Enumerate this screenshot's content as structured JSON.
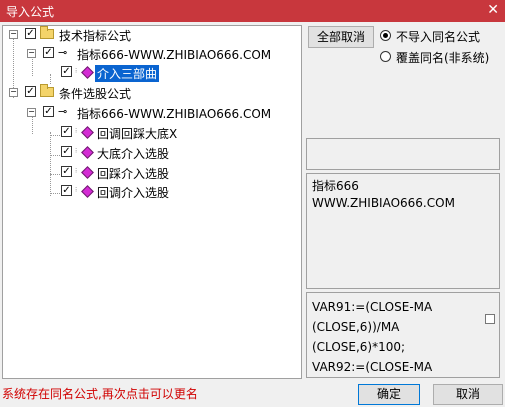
{
  "window": {
    "title": "导入公式",
    "close_glyph": "✕"
  },
  "tree": {
    "groups": [
      {
        "label": "技术指标公式",
        "author": "指标666-WWW.ZHIBIAO666.COM",
        "items": [
          {
            "label": "介入三部曲",
            "selected": true
          }
        ]
      },
      {
        "label": "条件选股公式",
        "author": "指标666-WWW.ZHIBIAO666.COM",
        "items": [
          {
            "label": "回调回踩大底X"
          },
          {
            "label": "大底介入选股"
          },
          {
            "label": "回踩介入选股"
          },
          {
            "label": "回调介入选股"
          }
        ]
      }
    ],
    "expand_glyph": "−",
    "check_glyph": "✓"
  },
  "options": {
    "cancel_all_label": "全部取消",
    "radio_no_import": "不导入同名公式",
    "radio_overwrite": "覆盖同名(非系统)"
  },
  "info": {
    "line1": "指标666",
    "line2": "WWW.ZHIBIAO666.COM"
  },
  "formula": {
    "text": "VAR91:=(CLOSE-MA\n(CLOSE,6))/MA\n(CLOSE,6)*100;\nVAR92:=(CLOSE-MA"
  },
  "footer": {
    "status": "系统存在同名公式,再次点击可以更名",
    "ok_label": "确定",
    "cancel_label": "取消"
  }
}
